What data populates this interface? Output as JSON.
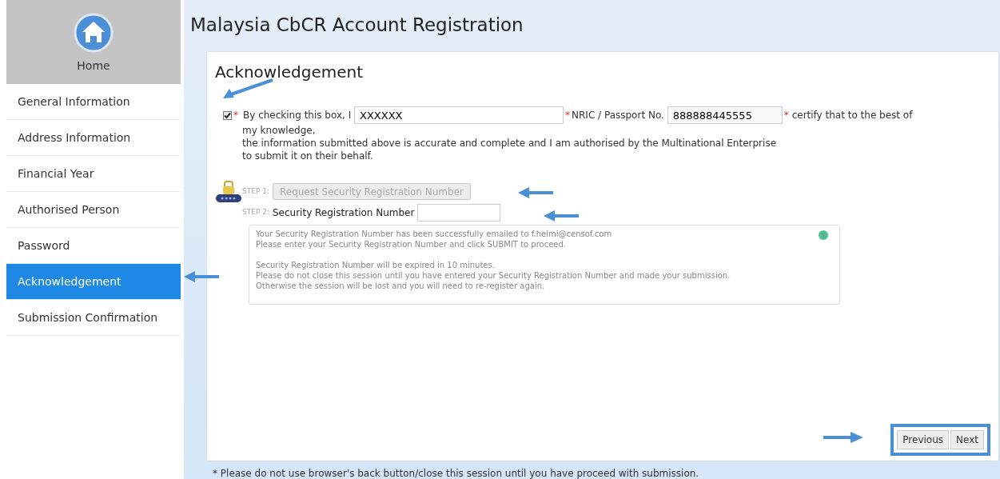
{
  "page_title": "Malaysia CbCR Account Registration",
  "sidebar": {
    "home_label": "Home",
    "items": [
      {
        "label": "General Information",
        "selected": false
      },
      {
        "label": "Address Information",
        "selected": false
      },
      {
        "label": "Financial Year",
        "selected": false
      },
      {
        "label": "Authorised Person",
        "selected": false
      },
      {
        "label": "Password",
        "selected": false
      },
      {
        "label": "Acknowledgement",
        "selected": true
      },
      {
        "label": "Submission Confirmation",
        "selected": false
      }
    ]
  },
  "card": {
    "heading": "Acknowledgement",
    "declaration": {
      "checked": true,
      "required_mark": "*",
      "lead": "By checking this box, I",
      "name_value": "XXXXXX",
      "nric_label": "NRIC / Passport No.",
      "nric_value": "888888445555",
      "certify": "certify that to the best of",
      "lines": [
        "my knowledge,",
        "the information submitted above is accurate and complete and I am authorised by the Multinational Enterprise",
        "to submit it on their behalf."
      ]
    },
    "step1": {
      "label": "STEP 1:",
      "button": "Request Security Registration Number",
      "disabled": true
    },
    "step2": {
      "label": "STEP 2:",
      "field_label": "Security Registration Number"
    },
    "message": [
      [
        "Your Security Registration Number has been successfully emailed to f.helmi@censof.com",
        "Please enter your Security Registration Number and click SUBMIT to proceed."
      ],
      [
        "Security Registration Number will be expired in 10 minutes.",
        "Please do not close this session until you have entered your Security Registration Number and made your submission.",
        "Otherwise the session will be lost and you will need to re-register again."
      ]
    ],
    "buttons": [
      "Previous",
      "Next"
    ]
  },
  "footer_note": "* Please do not use browser's back button/close this session until you have proceed with submission."
}
